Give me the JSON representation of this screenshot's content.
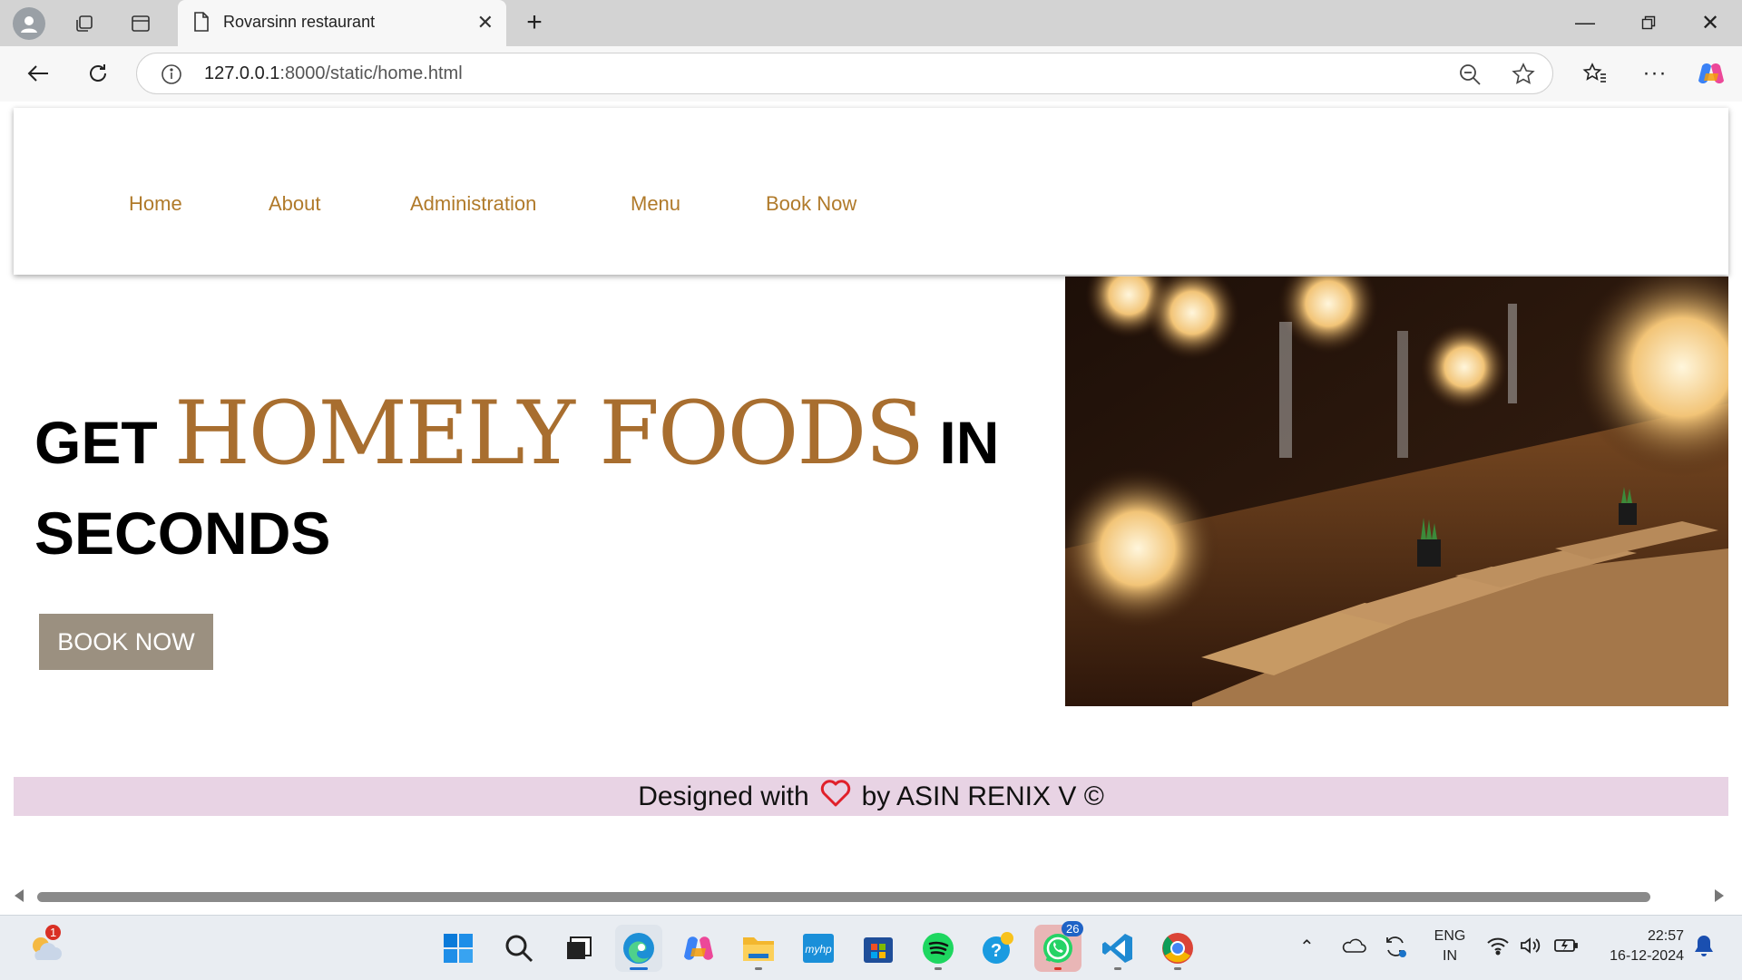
{
  "browser": {
    "tab_title": "Rovarsinn restaurant",
    "url_host": "127.0.0.1",
    "url_path": ":8000/static/home.html"
  },
  "nav": {
    "items": [
      "Home",
      "About",
      "Administration",
      "Menu",
      "Book Now"
    ]
  },
  "hero": {
    "line1_start": "GET",
    "accent": "HOMELY FOODS",
    "line1_end": "IN",
    "line2": "SECONDS",
    "button": "BOOK NOW"
  },
  "footer": {
    "text_before": "Designed with",
    "text_after": "by ASIN RENIX V ©",
    "heart_color": "#e0202a"
  },
  "taskbar": {
    "weather_badge": "1",
    "whatsapp_badge": "26",
    "language_line1": "ENG",
    "language_line2": "IN",
    "time": "22:57",
    "date": "16-12-2024"
  },
  "colors": {
    "nav_link": "#b07a2a",
    "accent": "#a86e2f",
    "button_bg": "#9b9080",
    "footer_bg": "#e8d3e4"
  }
}
